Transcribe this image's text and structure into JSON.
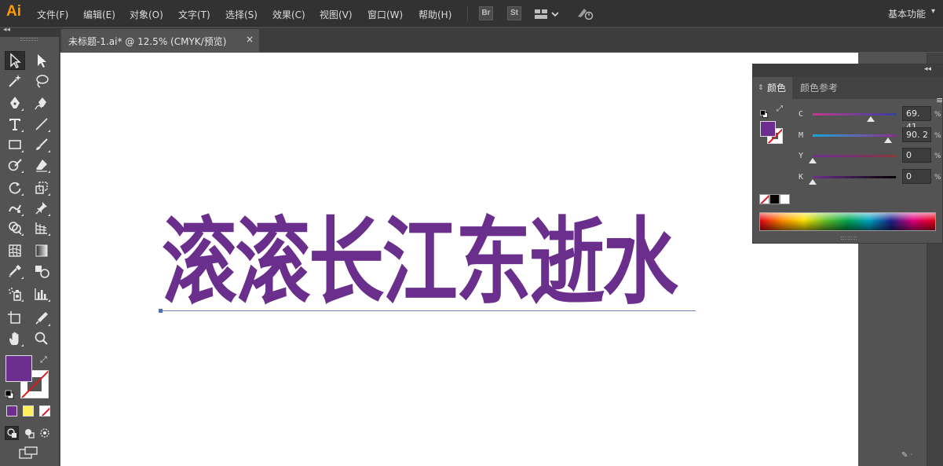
{
  "app": {
    "logo": "Ai"
  },
  "menu": [
    "文件(F)",
    "编辑(E)",
    "对象(O)",
    "文字(T)",
    "选择(S)",
    "效果(C)",
    "视图(V)",
    "窗口(W)",
    "帮助(H)"
  ],
  "toolbar_icons": {
    "bridge": "Br",
    "stock": "St",
    "arrange": "arrange-documents-icon",
    "gpu": "gpu-performance-icon"
  },
  "workspace": {
    "label": "基本功能",
    "caret": "▾"
  },
  "document_tab": {
    "title": "未标题-1.ai* @ 12.5% (CMYK/预览)",
    "close": "×"
  },
  "artboard": {
    "headline": "滚滚长江东逝水",
    "text_color": "#6a2f8c"
  },
  "tools": [
    "selection-tool",
    "direct-selection-tool",
    "magic-wand-tool",
    "lasso-tool",
    "pen-tool",
    "curvature-tool",
    "type-tool",
    "line-segment-tool",
    "rectangle-tool",
    "paintbrush-tool",
    "shaper-tool",
    "eraser-tool",
    "rotate-tool",
    "scale-tool",
    "warp-tool",
    "free-transform-tool",
    "shape-builder-tool",
    "perspective-grid-tool",
    "mesh-tool",
    "gradient-tool",
    "eyedropper-tool",
    "blend-tool",
    "symbol-sprayer-tool",
    "column-graph-tool",
    "artboard-tool",
    "slice-tool",
    "hand-tool",
    "zoom-tool"
  ],
  "colors": {
    "fill": "#6c2f8f",
    "stroke": "none",
    "none_slash": "#e0191f",
    "gradient_yellow": "#ffef5a"
  },
  "color_panel": {
    "tab_active": "颜色",
    "tab_inactive": "颜色参考",
    "sliders": [
      {
        "label": "C",
        "value": "69. 41",
        "level": 69.41,
        "gradient": "linear-gradient(to right,#c03a8f,#7a3f98,#3a3f9c)"
      },
      {
        "label": "M",
        "value": "90. 2",
        "level": 90.2,
        "gradient": "linear-gradient(to right,#14a6d4,#5f6ab4,#8a2d91)"
      },
      {
        "label": "Y",
        "value": "0",
        "level": 0,
        "gradient": "linear-gradient(to right,#6e2f8f,#7a2f6f,#8a3a3a)"
      },
      {
        "label": "K",
        "value": "0",
        "level": 0,
        "gradient": "linear-gradient(to right,#6e2f8f,#3a1a4a,#000000)"
      }
    ],
    "percent_sign": "%"
  }
}
